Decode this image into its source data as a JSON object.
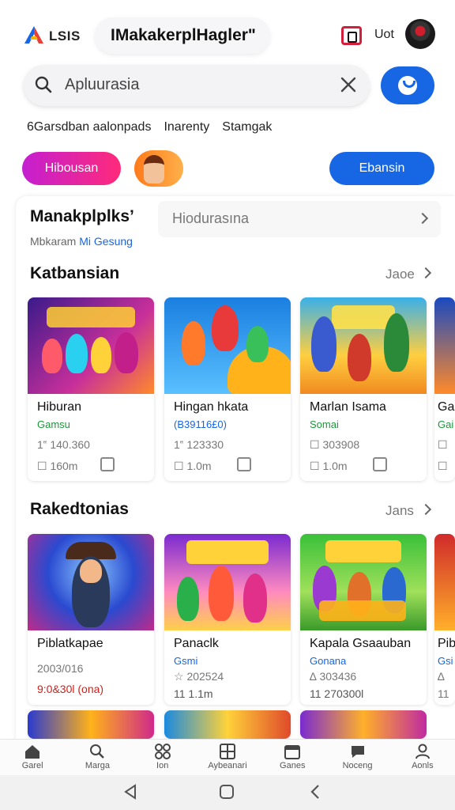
{
  "header": {
    "logo_text": "LSIS",
    "app_title": "IMakakerplHagler\"",
    "user_label": "Uot"
  },
  "search": {
    "placeholder": "Apluurasia",
    "icon": "search-icon",
    "clear_icon": "close-icon"
  },
  "chips": [
    "6Garsdban aalonpads",
    "Inarenty",
    "Stamgak"
  ],
  "pills": {
    "left_label": "Hibousan",
    "right_label": "Ebansin"
  },
  "market": {
    "title": "Manakplplks’",
    "subtitle_plain": "Mbkaram",
    "subtitle_accent": "Mi Gesung",
    "field_text": "Hiodurasına"
  },
  "sections": [
    {
      "title": "Katbansian",
      "more_label": "Jaoe",
      "games": [
        {
          "name": "Hiburan",
          "genre": "Gamsu",
          "stat1": "1‟ 140.360",
          "stat2": "☐ 160m",
          "genre_color": "#1a9a3a"
        },
        {
          "name": "Hingan hkata",
          "genre": "(B39116£0)",
          "stat1": "1‟ 123330",
          "stat2": "☐ 1.0m",
          "genre_color": "#1766e3"
        },
        {
          "name": "Marlan Isama",
          "genre": "Somai",
          "stat1": "☐ 303908",
          "stat2": "☐ 1.0m",
          "genre_color": "#1a9a3a"
        },
        {
          "name": "Ga",
          "genre": "Gai",
          "stat1": "☐",
          "stat2": "☐",
          "genre_color": "#1a9a3a"
        }
      ]
    },
    {
      "title": "Rakedtonias",
      "more_label": "Jans",
      "games": [
        {
          "name": "Piblatkapae",
          "genre": "",
          "stat1": "2003/016",
          "stat2": "9:0&30l (ona)",
          "genre_color": "#1766e3"
        },
        {
          "name": "Panaclk",
          "genre": "Gsmi",
          "stat1": "☆ 202524",
          "stat2": "11 1.1m",
          "genre_color": "#1766e3"
        },
        {
          "name": "Kapala Gsaauban",
          "genre": "Gonana",
          "stat1": "∆ 303436",
          "stat2": "11 270300l",
          "genre_color": "#1766e3"
        },
        {
          "name": "Pib",
          "genre": "Gsi",
          "stat1": "∆",
          "stat2": "11",
          "genre_color": "#1766e3"
        }
      ]
    }
  ],
  "bottom_nav": [
    {
      "label": "Garel",
      "icon": "home-icon"
    },
    {
      "label": "Marga",
      "icon": "search-icon"
    },
    {
      "label": "Ion",
      "icon": "apps-icon"
    },
    {
      "label": "Aybeanari",
      "icon": "grid-icon"
    },
    {
      "label": "Ganes",
      "icon": "games-icon"
    },
    {
      "label": "Noceng",
      "icon": "chat-icon"
    },
    {
      "label": "Aonls",
      "icon": "profile-icon"
    }
  ],
  "colors": {
    "accent_blue": "#1766e3",
    "gradient_start": "#c41fd1",
    "gradient_end": "#ff2a7a",
    "genre_green": "#1a9a3a"
  }
}
